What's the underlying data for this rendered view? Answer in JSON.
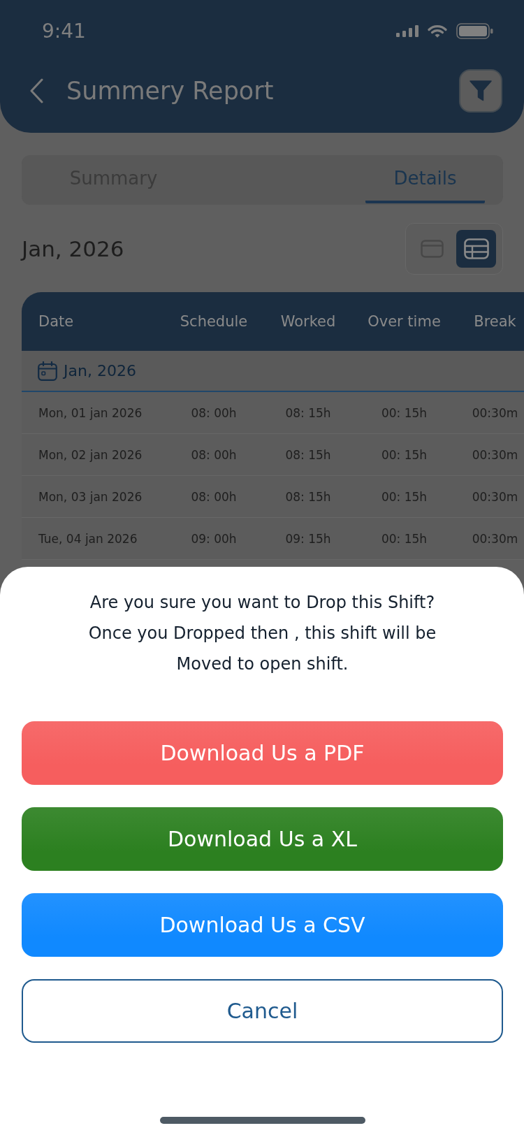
{
  "status_bar": {
    "time": "9:41"
  },
  "header": {
    "title": "Summery Report"
  },
  "tabs": [
    {
      "label": "Summary",
      "selected": false
    },
    {
      "label": "Details",
      "selected": true
    }
  ],
  "period": {
    "label": "Jan, 2026"
  },
  "view_toggle": [
    {
      "kind": "card",
      "selected": false
    },
    {
      "kind": "table",
      "selected": true
    }
  ],
  "table": {
    "columns": [
      "Date",
      "Schedule",
      "Worked",
      "Over time",
      "Break"
    ],
    "group_label": "Jan, 2026",
    "rows": [
      [
        "Mon, 01 jan 2026",
        "08: 00h",
        "08: 15h",
        "00: 15h",
        "00:30m"
      ],
      [
        "Mon, 02 jan 2026",
        "08: 00h",
        "08: 15h",
        "00: 15h",
        "00:30m"
      ],
      [
        "Mon, 03 jan 2026",
        "08: 00h",
        "08: 15h",
        "00: 15h",
        "00:30m"
      ],
      [
        "Tue, 04 jan 2026",
        "09: 00h",
        "09: 15h",
        "00: 15h",
        "00:30m"
      ]
    ]
  },
  "sheet": {
    "message_lines": [
      "Are you sure you want to Drop this Shift?",
      "Once you Dropped then , this shift will be",
      "Moved to open shift."
    ],
    "buttons": [
      {
        "label": "Download Us a PDF",
        "kind": "filled",
        "color": "#f65e5e"
      },
      {
        "label": "Download Us a XL",
        "kind": "filled",
        "color": "#2c8020"
      },
      {
        "label": "Download Us a CSV",
        "kind": "filled",
        "color": "#1089ff"
      },
      {
        "label": "Cancel",
        "kind": "outline",
        "color": "#1f5a8e"
      }
    ]
  }
}
